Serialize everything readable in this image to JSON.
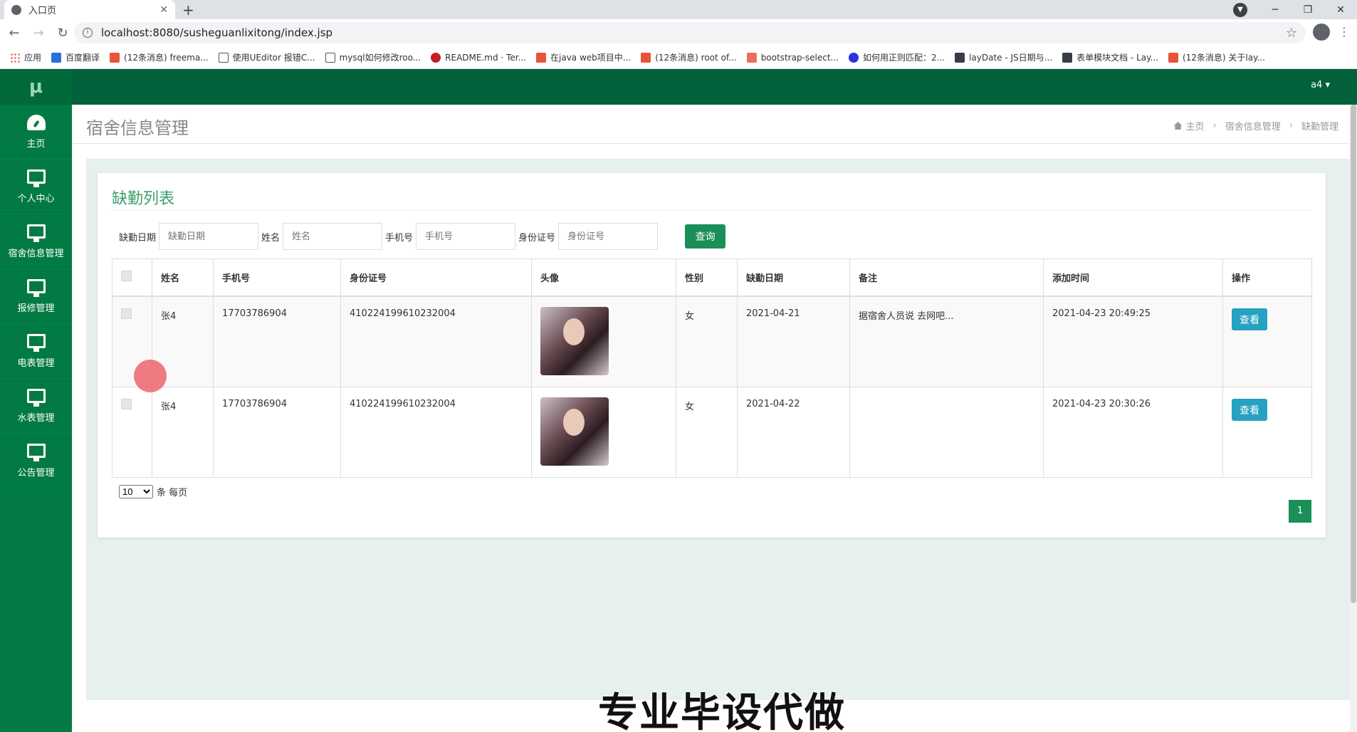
{
  "browser": {
    "tab_title": "入口页",
    "url": "localhost:8080/susheguanlixitong/index.jsp",
    "bookmarks": [
      "应用",
      "百度翻译",
      "(12条消息) freema...",
      "使用UEditor 报错C...",
      "mysql如何修改roo...",
      "README.md · Ter...",
      "在java web项目中...",
      "(12条消息) root of...",
      "bootstrap-select...",
      "如何用正则匹配：2...",
      "layDate - JS日期与...",
      "表单模块文档 - Lay...",
      "(12条消息) 关于lay..."
    ]
  },
  "app": {
    "logo": "μ",
    "user": "a4 ▾",
    "sidebar": [
      {
        "label": "主页"
      },
      {
        "label": "个人中心"
      },
      {
        "label": "宿舍信息管理"
      },
      {
        "label": "报修管理"
      },
      {
        "label": "电表管理"
      },
      {
        "label": "水表管理"
      },
      {
        "label": "公告管理"
      }
    ],
    "page_title": "宿舍信息管理",
    "breadcrumb": [
      "主页",
      "宿舍信息管理",
      "缺勤管理"
    ]
  },
  "card": {
    "title": "缺勤列表",
    "search": {
      "date_label": "缺勤日期",
      "date_placeholder": "缺勤日期",
      "name_label": "姓名",
      "name_placeholder": "姓名",
      "phone_label": "手机号",
      "phone_placeholder": "手机号",
      "id_label": "身份证号",
      "id_placeholder": "身份证号",
      "query_button": "查询"
    },
    "columns": [
      "姓名",
      "手机号",
      "身份证号",
      "头像",
      "性别",
      "缺勤日期",
      "备注",
      "添加时间",
      "操作"
    ],
    "rows": [
      {
        "name": "张4",
        "phone": "17703786904",
        "id": "410224199610232004",
        "gender": "女",
        "date": "2021-04-21",
        "remark": "据宿舍人员说 去网吧...",
        "added": "2021-04-23 20:49:25",
        "action": "查看"
      },
      {
        "name": "张4",
        "phone": "17703786904",
        "id": "410224199610232004",
        "gender": "女",
        "date": "2021-04-22",
        "remark": "",
        "added": "2021-04-23 20:30:26",
        "action": "查看"
      }
    ],
    "page_size": "10",
    "per_page_label": "条 每页",
    "current_page": "1"
  },
  "watermark": "专业毕设代做",
  "colors": {
    "sidebar": "#017a43",
    "topnav": "#02603a",
    "accent": "#1a8f57",
    "view_button": "#25a1c2"
  }
}
